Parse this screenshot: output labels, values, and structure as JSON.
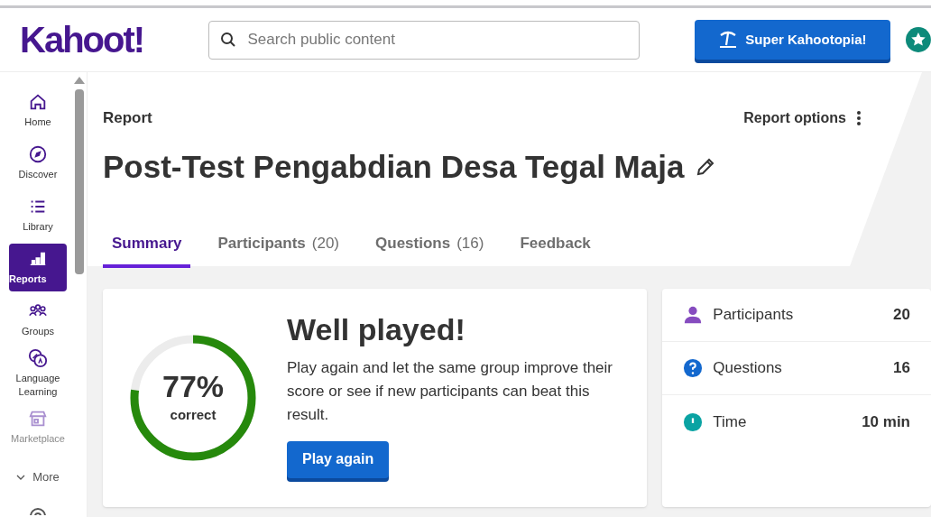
{
  "header": {
    "logo": "Kahoot!",
    "search": {
      "placeholder": "Search public content"
    },
    "upgrade_button": "Super Kahootopia!"
  },
  "sidebar": {
    "items": [
      {
        "label": "Home",
        "kind": "home",
        "selected": false,
        "disabled": false
      },
      {
        "label": "Discover",
        "kind": "discover",
        "selected": false,
        "disabled": false
      },
      {
        "label": "Library",
        "kind": "library",
        "selected": false,
        "disabled": false
      },
      {
        "label": "Reports",
        "kind": "reports",
        "selected": true,
        "disabled": false
      },
      {
        "label": "Groups",
        "kind": "groups",
        "selected": false,
        "disabled": false
      },
      {
        "label": "Language Learning",
        "kind": "language",
        "selected": false,
        "disabled": false
      },
      {
        "label": "Marketplace",
        "kind": "marketplace",
        "selected": false,
        "disabled": true
      }
    ],
    "more": "More"
  },
  "report": {
    "label": "Report",
    "options": "Report options",
    "title": "Post-Test Pengabdian Desa Tegal Maja"
  },
  "tabs": [
    {
      "label": "Summary",
      "selected": true
    },
    {
      "label": "Participants",
      "count": "(20)",
      "selected": false
    },
    {
      "label": "Questions",
      "count": "(16)",
      "selected": false
    },
    {
      "label": "Feedback",
      "selected": false
    }
  ],
  "summary": {
    "level": 0.77,
    "percent": "77%",
    "caption": "correct",
    "heading": "Well played!",
    "text": "Play again and let the same group improve their score or see if new participants can beat this result.",
    "button": "Play again"
  },
  "stats": [
    {
      "kind": "participants",
      "label": "Participants",
      "value": "20"
    },
    {
      "kind": "questions",
      "label": "Questions",
      "value": "16"
    },
    {
      "kind": "time",
      "label": "Time",
      "value": "10 min"
    }
  ]
}
